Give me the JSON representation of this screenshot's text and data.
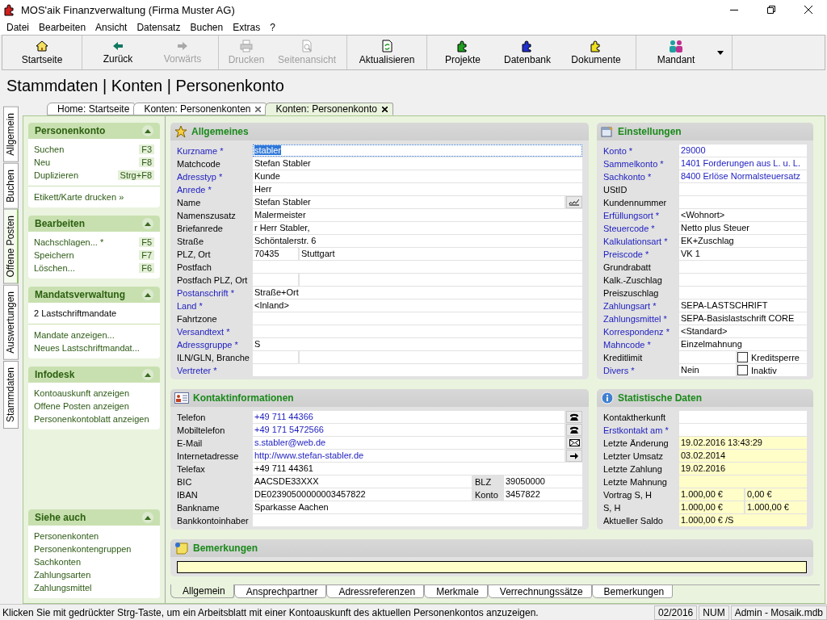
{
  "window": {
    "title": "MOS'aik Finanzverwaltung (Firma Muster AG)"
  },
  "menu": [
    "Datei",
    "Bearbeiten",
    "Ansicht",
    "Datensatz",
    "Buchen",
    "Extras",
    "?"
  ],
  "toolbar": {
    "groups": [
      [
        {
          "label": "Startseite",
          "disabled": false
        }
      ],
      [
        {
          "label": "Zurück",
          "disabled": false
        },
        {
          "label": "Vorwärts",
          "disabled": true
        }
      ],
      [
        {
          "label": "Drucken",
          "disabled": true
        },
        {
          "label": "Seitenansicht",
          "disabled": true
        }
      ],
      [
        {
          "label": "Aktualisieren",
          "disabled": false
        }
      ],
      [
        {
          "label": "Projekte",
          "disabled": false
        },
        {
          "label": "Datenbank",
          "disabled": false
        },
        {
          "label": "Dokumente",
          "disabled": false
        }
      ],
      [
        {
          "label": "Mandant",
          "disabled": false
        }
      ]
    ]
  },
  "breadcrumb": "Stammdaten | Konten | Personenkonto",
  "doc_tabs": [
    {
      "label": "Home: Startseite",
      "selected": false,
      "closable": false
    },
    {
      "label": "Konten: Personenkonten",
      "selected": false,
      "closable": true
    },
    {
      "label": "Konten: Personenkonto",
      "selected": true,
      "closable": true
    }
  ],
  "side_tabs": [
    {
      "label": "Allgemein",
      "selected": false
    },
    {
      "label": "Buchen",
      "selected": false
    },
    {
      "label": "Offene Posten",
      "selected": true
    },
    {
      "label": "Auswertungen",
      "selected": false
    },
    {
      "label": "Stammdaten",
      "selected": false
    }
  ],
  "task_panels": [
    {
      "title": "Personenkonto",
      "expanded": true,
      "sections": [
        [
          {
            "label": "Suchen",
            "shortcut": "F3",
            "kind": "link"
          },
          {
            "label": "Neu",
            "shortcut": "F8",
            "kind": "link"
          },
          {
            "label": "Duplizieren",
            "shortcut": "Strg+F8",
            "kind": "link"
          }
        ],
        [
          {
            "label": "Etikett/Karte drucken »",
            "kind": "link"
          }
        ]
      ]
    },
    {
      "title": "Bearbeiten",
      "expanded": true,
      "sections": [
        [
          {
            "label": "Nachschlagen... *",
            "shortcut": "F5",
            "kind": "link"
          },
          {
            "label": "Speichern",
            "shortcut": "F7",
            "kind": "link"
          },
          {
            "label": "Löschen...",
            "shortcut": "F6",
            "kind": "link"
          }
        ]
      ]
    },
    {
      "title": "Mandatsverwaltung",
      "expanded": true,
      "sections": [
        [
          {
            "label": "2 Lastschriftmandate",
            "kind": "info"
          }
        ],
        [
          {
            "label": "Mandate anzeigen...",
            "kind": "link"
          },
          {
            "label": "Neues Lastschriftmandat...",
            "kind": "link"
          }
        ]
      ]
    },
    {
      "title": "Infodesk",
      "expanded": true,
      "sections": [
        [
          {
            "label": "Kontoauskunft anzeigen",
            "kind": "link"
          },
          {
            "label": "Offene Posten anzeigen",
            "kind": "link"
          },
          {
            "label": "Personenkontoblatt anzeigen",
            "kind": "link"
          }
        ]
      ]
    }
  ],
  "see_also": {
    "title": "Siehe auch",
    "expanded": true,
    "sections": [
      [
        {
          "label": "Personenkonten",
          "kind": "link"
        },
        {
          "label": "Personenkontengruppen",
          "kind": "link"
        },
        {
          "label": "Sachkonten",
          "kind": "link"
        },
        {
          "label": "Zahlungsarten",
          "kind": "link"
        },
        {
          "label": "Zahlungsmittel",
          "kind": "link"
        }
      ]
    ]
  },
  "allgemeines": {
    "title": "Allgemeines",
    "fields": [
      {
        "label": "Kurzname *",
        "required": true,
        "kind": "text",
        "value": "stabler",
        "selected": true
      },
      {
        "label": "Matchcode",
        "required": false,
        "kind": "text",
        "value": "Stefan Stabler",
        "selected": false
      },
      {
        "label": "Adresstyp *",
        "required": true,
        "kind": "text",
        "value": "Kunde",
        "selected": false
      },
      {
        "label": "Anrede *",
        "required": true,
        "kind": "text",
        "value": "Herr",
        "selected": false
      },
      {
        "label": "Name",
        "required": false,
        "kind": "button",
        "value": "Stefan Stabler",
        "selected": false
      },
      {
        "label": "Namenszusatz",
        "required": false,
        "kind": "text",
        "value": "Malermeister",
        "selected": false
      },
      {
        "label": "Briefanrede",
        "required": false,
        "kind": "text",
        "value": "r Herr Stabler,",
        "selected": false
      },
      {
        "label": "Straße",
        "required": false,
        "kind": "text",
        "value": "Schöntalerstr. 6",
        "selected": false
      },
      {
        "label": "PLZ, Ort",
        "required": false,
        "kind": "split",
        "values": [
          "70435",
          "Stuttgart"
        ],
        "selected": false
      },
      {
        "label": "Postfach",
        "required": false,
        "kind": "text",
        "selected": false
      },
      {
        "label": "Postfach PLZ, Ort",
        "required": false,
        "kind": "split",
        "selected": false
      },
      {
        "label": "Postanschrift *",
        "required": true,
        "kind": "text",
        "value": "Straße+Ort",
        "selected": false
      },
      {
        "label": "Land *",
        "required": true,
        "kind": "text",
        "value": "<Inland>",
        "selected": false
      },
      {
        "label": "Fahrtzone",
        "required": false,
        "kind": "text",
        "selected": false
      },
      {
        "label": "Versandtext *",
        "required": true,
        "kind": "text",
        "selected": false
      },
      {
        "label": "Adressgruppe *",
        "required": true,
        "kind": "text",
        "value": "S",
        "selected": false
      },
      {
        "label": "ILN/GLN, Branche",
        "required": false,
        "kind": "split",
        "selected": false
      },
      {
        "label": "Vertreter *",
        "required": true,
        "kind": "text",
        "selected": false
      }
    ]
  },
  "einstellungen": {
    "title": "Einstellungen",
    "fields": [
      {
        "label": "Konto *",
        "required": true,
        "kind": "text",
        "value": "29000",
        "link": true
      },
      {
        "label": "Sammelkonto *",
        "required": true,
        "kind": "text",
        "value": "1401 Forderungen aus L. u. L.",
        "link": true
      },
      {
        "label": "Sachkonto *",
        "required": true,
        "kind": "text",
        "value": "8400 Erlöse Normalsteuersatz",
        "link": true
      },
      {
        "label": "UStID",
        "required": false,
        "kind": "text"
      },
      {
        "label": "Kundennummer",
        "required": false,
        "kind": "text"
      },
      {
        "label": "Erfüllungsort *",
        "required": true,
        "kind": "text",
        "value": "<Wohnort>",
        "link": false
      },
      {
        "label": "Steuercode *",
        "required": true,
        "kind": "text",
        "value": "Netto plus Steuer",
        "link": false
      },
      {
        "label": "Kalkulationsart *",
        "required": true,
        "kind": "text",
        "value": "EK+Zuschlag",
        "link": false
      },
      {
        "label": "Preiscode *",
        "required": true,
        "kind": "text",
        "value": "VK 1",
        "link": false
      },
      {
        "label": "Grundrabatt",
        "required": false,
        "kind": "text"
      },
      {
        "label": "Kalk.-Zuschlag",
        "required": false,
        "kind": "text"
      },
      {
        "label": "Preiszuschlag",
        "required": false,
        "kind": "text"
      },
      {
        "label": "Zahlungsart *",
        "required": true,
        "kind": "text",
        "value": "SEPA-LASTSCHRIFT",
        "link": false
      },
      {
        "label": "Zahlungsmittel *",
        "required": true,
        "kind": "text",
        "value": "SEPA-Basislastschrift CORE",
        "link": false
      },
      {
        "label": "Korrespondenz *",
        "required": true,
        "kind": "text",
        "value": "<Standard>",
        "link": false
      },
      {
        "label": "Mahncode *",
        "required": true,
        "kind": "text",
        "value": "Einzelmahnung",
        "link": false
      },
      {
        "label": "Kreditlimit",
        "required": false,
        "kind": "checkbox",
        "check_label": "Kreditsperre",
        "checked": false
      },
      {
        "label": "Divers *",
        "required": true,
        "kind": "checkbox",
        "value": "Nein",
        "check_label": "Inaktiv",
        "checked": false,
        "link": false
      }
    ]
  },
  "kontakt": {
    "title": "Kontaktinformationen",
    "fields": [
      {
        "label": "Telefon",
        "kind": "phone",
        "value": "+49 711 44366",
        "link": true
      },
      {
        "label": "Mobiltelefon",
        "kind": "phone",
        "value": "+49 171 5472566",
        "link": true
      },
      {
        "label": "E-Mail",
        "kind": "email",
        "value": "s.stabler@web.de",
        "link": true
      },
      {
        "label": "Internetadresse",
        "kind": "web",
        "value": "http://www.stefan-stabler.de",
        "link": true
      },
      {
        "label": "Telefax",
        "kind": "text",
        "value": "+49 711 44361",
        "link": false
      },
      {
        "label": "BIC",
        "kind": "pair",
        "value": "AACSDE33XXX",
        "label2": "BLZ",
        "value2": "39050000",
        "link": false
      },
      {
        "label": "IBAN",
        "kind": "pair",
        "value": "DE02390500000003457822",
        "label2": "Konto",
        "value2": "3457822",
        "link": false
      },
      {
        "label": "Bankname",
        "kind": "text",
        "value": "Sparkasse Aachen",
        "link": false
      },
      {
        "label": "Bankkontoinhaber",
        "kind": "text"
      }
    ]
  },
  "statistik": {
    "title": "Statistische Daten",
    "fields": [
      {
        "label": "Kontaktherkunft",
        "required": false,
        "kind": "text",
        "readonly": false
      },
      {
        "label": "Erstkontakt am *",
        "required": true,
        "kind": "text",
        "readonly": false
      },
      {
        "label": "Letzte Änderung",
        "required": false,
        "kind": "text",
        "value": "19.02.2016 13:43:29",
        "readonly": true
      },
      {
        "label": "Letzter Umsatz",
        "required": false,
        "kind": "text",
        "value": "03.02.2014",
        "readonly": true
      },
      {
        "label": "Letzte Zahlung",
        "required": false,
        "kind": "text",
        "value": "19.02.2016",
        "readonly": true
      },
      {
        "label": "Letzte Mahnung",
        "required": false,
        "kind": "text",
        "readonly": true
      },
      {
        "label": "Vortrag S, H",
        "required": false,
        "kind": "split",
        "values": [
          "1.000,00 €",
          "0,00 €"
        ],
        "readonly": true
      },
      {
        "label": "S, H",
        "required": false,
        "kind": "split",
        "values": [
          "1.000,00 €",
          "1.000,00 €"
        ],
        "readonly": true
      },
      {
        "label": "Aktueller Saldo",
        "required": false,
        "kind": "text",
        "value": "1.000,00 € /S",
        "readonly": true
      }
    ]
  },
  "bemerkungen": {
    "title": "Bemerkungen"
  },
  "bottom_tabs": [
    {
      "label": "Allgemein",
      "selected": true
    },
    {
      "label": "Ansprechpartner",
      "selected": false
    },
    {
      "label": "Adressreferenzen",
      "selected": false
    },
    {
      "label": "Merkmale",
      "selected": false
    },
    {
      "label": "Verrechnungssätze",
      "selected": false
    },
    {
      "label": "Bemerkungen",
      "selected": false
    }
  ],
  "status_bar": {
    "message": "Klicken Sie mit gedrückter Strg-Taste, um ein Arbeitsblatt mit einer Kontoauskunft des aktuellen Personenkontos anzuzeigen.",
    "cells": [
      "02/2016",
      "NUM",
      "Admin - Mosaik.mdb"
    ]
  }
}
